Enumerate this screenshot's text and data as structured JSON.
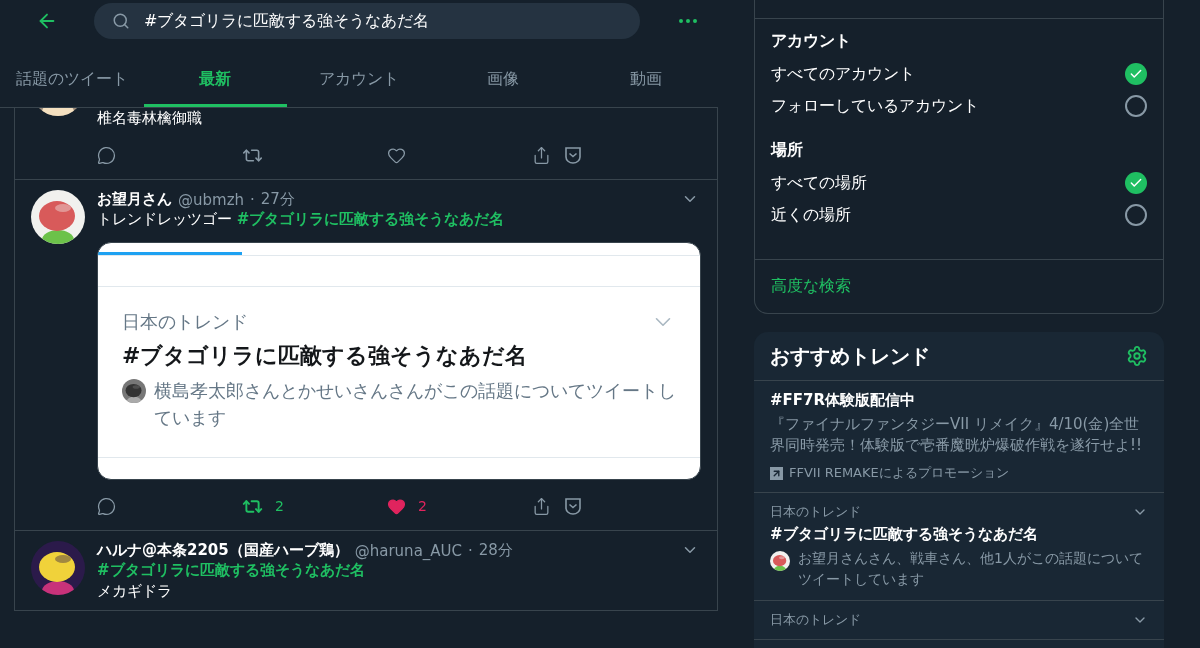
{
  "search": {
    "value": "#ブタゴリラに匹敵する強そうなあだ名"
  },
  "tabs": [
    {
      "label": "話題のツイート",
      "selected": false
    },
    {
      "label": "最新",
      "selected": true
    },
    {
      "label": "アカウント",
      "selected": false
    },
    {
      "label": "画像",
      "selected": false
    },
    {
      "label": "動画",
      "selected": false
    }
  ],
  "tweets": [
    {
      "kind": "partial",
      "lines": [
        [
          {
            "text": "椎名毒林檎御職",
            "kind": "plain"
          }
        ]
      ],
      "actions": [
        {
          "kind": "reply"
        },
        {
          "kind": "retweet",
          "active": false
        },
        {
          "kind": "like",
          "active": false
        },
        {
          "kind": "share"
        }
      ]
    },
    {
      "kind": "full",
      "name": "お望月さん",
      "handle": "@ubmzh",
      "separator": "·",
      "time": "27分",
      "lines": [
        [
          {
            "text": "トレンドレッツゴー ",
            "kind": "plain"
          },
          {
            "text": "#ブタゴリラに匹敵する強そうなあだ名",
            "kind": "hashtag"
          }
        ]
      ],
      "card": {
        "level": 0.24,
        "label": "日本のトレンド",
        "title": "#ブタゴリラに匹敵する強そうなあだ名",
        "note": "横島孝太郎さんとかせいさんさんがこの話題についてツイートしています"
      },
      "actions": [
        {
          "kind": "reply"
        },
        {
          "kind": "retweet",
          "active": true,
          "count": "2"
        },
        {
          "kind": "like",
          "active": true,
          "count": "2"
        },
        {
          "kind": "share"
        }
      ]
    },
    {
      "kind": "full",
      "name": "ハルナ@本条2205（国産ハーブ鶏）",
      "handle": "@haruna_AUC",
      "separator": "·",
      "time": "28分",
      "lines": [
        [
          {
            "text": "#ブタゴリラに匹敵する強そうなあだ名",
            "kind": "hashtag"
          }
        ],
        [
          {
            "text": "メカギドラ",
            "kind": "plain"
          }
        ]
      ]
    }
  ],
  "filters": {
    "sections": [
      {
        "heading": "アカウント",
        "options": [
          {
            "label": "すべてのアカウント",
            "selected": true
          },
          {
            "label": "フォローしているアカウント",
            "selected": false
          }
        ]
      },
      {
        "heading": "場所",
        "options": [
          {
            "label": "すべての場所",
            "selected": true
          },
          {
            "label": "近くの場所",
            "selected": false
          }
        ]
      }
    ],
    "link": "高度な検索"
  },
  "trends": {
    "title": "おすすめトレンド",
    "items": [
      {
        "kind": "promoted",
        "title": "#FF7R体験版配信中",
        "description": "『ファイナルファンタジーVII リメイク』4/10(金)全世界同時発売！体験版で壱番魔晄炉爆破作戦を遂行せよ!!",
        "promoter": "FFVII REMAKEによるプロモーション"
      },
      {
        "kind": "trend",
        "context": "日本のトレンド",
        "title": "#ブタゴリラに匹敵する強そうなあだ名",
        "note": "お望月さんさん、戦車さん、他1人がこの話題についてツイートしています"
      },
      {
        "kind": "trend",
        "context": "日本のトレンド"
      }
    ]
  }
}
